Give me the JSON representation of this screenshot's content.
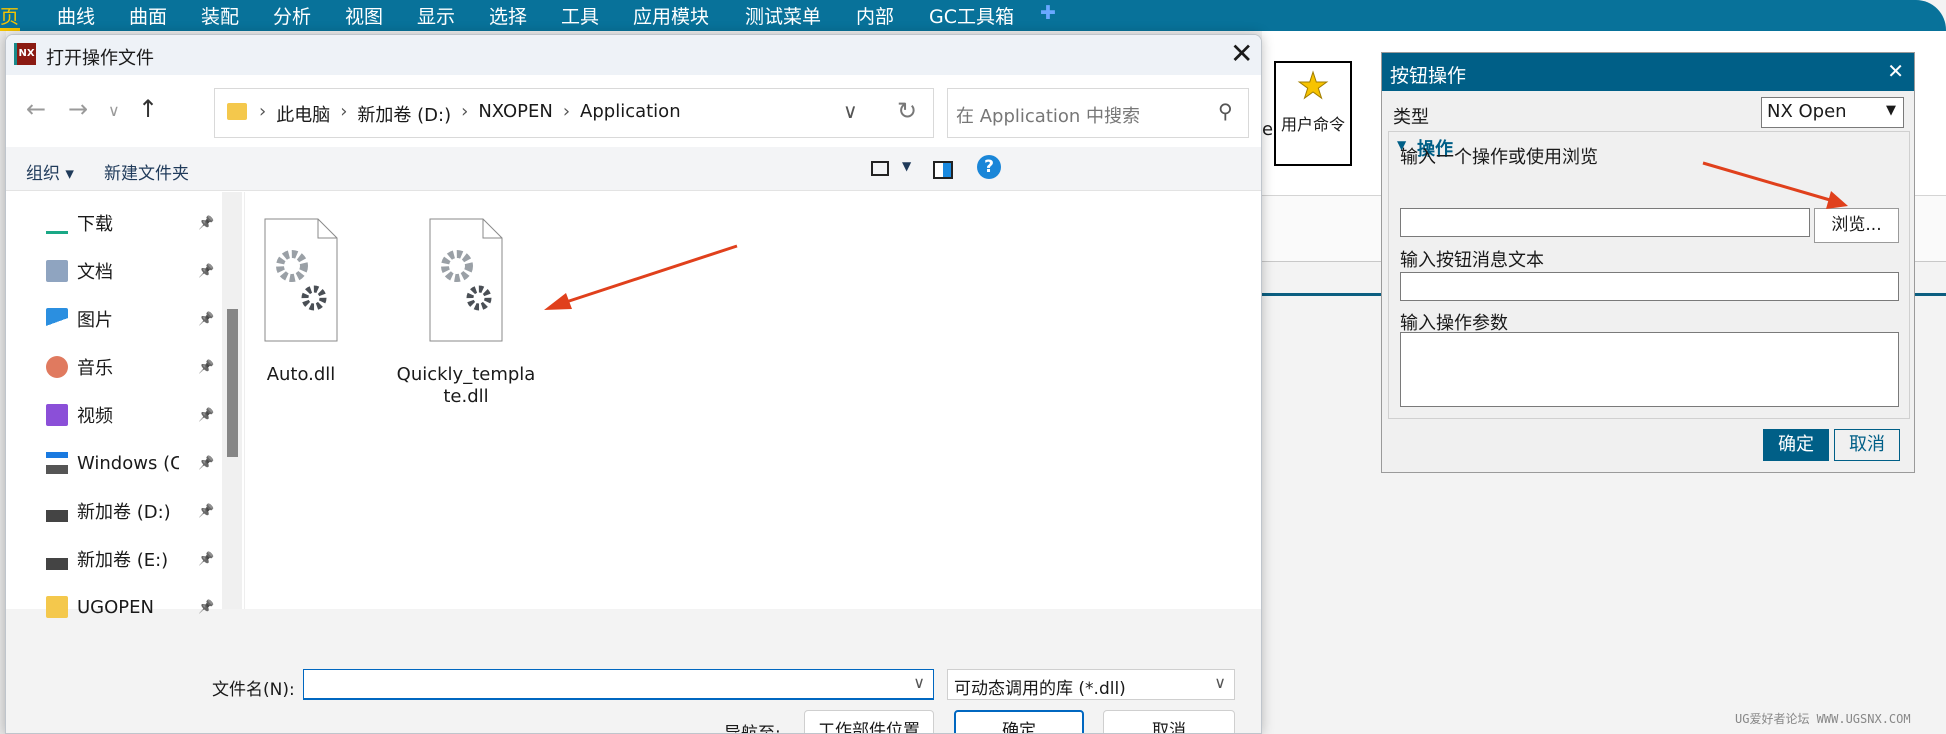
{
  "menubar": {
    "items": [
      "页",
      "曲线",
      "曲面",
      "装配",
      "分析",
      "视图",
      "显示",
      "选择",
      "工具",
      "应用模块",
      "测试菜单",
      "内部",
      "GC工具箱"
    ],
    "add_icon": "plus-icon",
    "accent": "#08729a"
  },
  "ribbon": {
    "user_command_label": "用户命令",
    "partial_text": "e"
  },
  "file_dialog": {
    "title": "打开操作文件",
    "breadcrumb": [
      "此电脑",
      "新加卷 (D:)",
      "NXOPEN",
      "Application"
    ],
    "search_placeholder": "在 Application 中搜索",
    "toolbar": {
      "organize": "组织",
      "new_folder": "新建文件夹"
    },
    "sidebar": [
      {
        "label": "下载",
        "icon": "download-icon"
      },
      {
        "label": "文档",
        "icon": "document-icon"
      },
      {
        "label": "图片",
        "icon": "pictures-icon"
      },
      {
        "label": "音乐",
        "icon": "music-icon"
      },
      {
        "label": "视频",
        "icon": "video-icon"
      },
      {
        "label": "Windows (C:)",
        "icon": "drive-c-icon"
      },
      {
        "label": "新加卷 (D:)",
        "icon": "drive-icon"
      },
      {
        "label": "新加卷 (E:)",
        "icon": "drive-icon"
      },
      {
        "label": "UGOPEN",
        "icon": "folder-icon"
      }
    ],
    "files": [
      {
        "name": "Auto.dll",
        "name_line2": ""
      },
      {
        "name": "Quickly_templa",
        "name_line2": "te.dll"
      }
    ],
    "filename_label": "文件名(N):",
    "filename_value": "",
    "filter": "可动态调用的库 (*.dll)",
    "navigate_label": "导航至:",
    "work_part_button": "工作部件位置",
    "ok": "确定",
    "cancel": "取消"
  },
  "nx_dialog": {
    "title": "按钮操作",
    "type_label": "类型",
    "type_value": "NX Open",
    "group_title": "操作",
    "field1_label": "输入一个操作或使用浏览",
    "browse": "浏览...",
    "field2_label": "输入按钮消息文本",
    "field3_label": "输入操作参数",
    "ok": "确定",
    "cancel": "取消",
    "accent": "#005f87"
  },
  "watermark": "UG爱好者论坛 WWW.UGSNX.COM"
}
